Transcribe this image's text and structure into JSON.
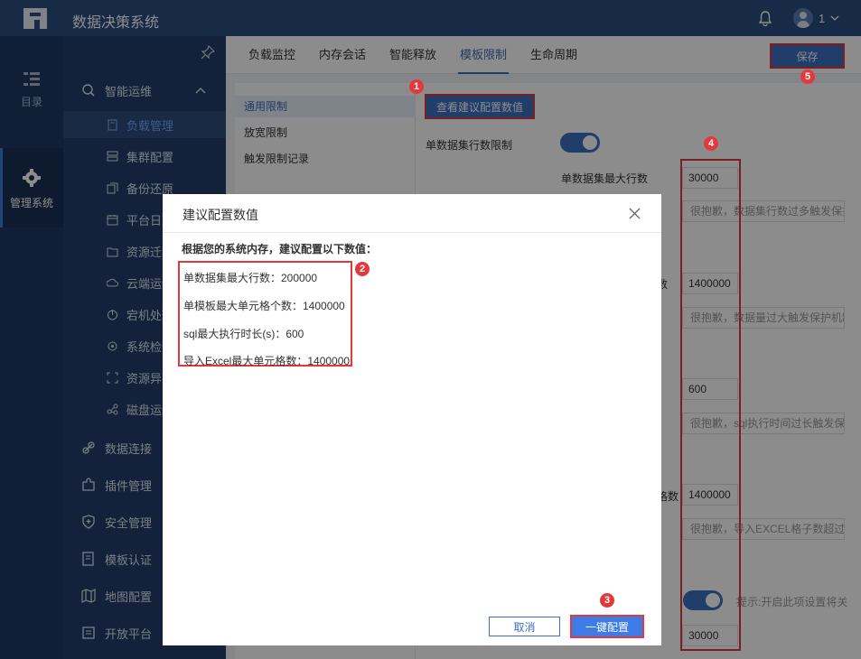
{
  "app": {
    "title": "数据决策系统",
    "user": "1"
  },
  "rail": [
    {
      "label": "目录",
      "icon": "list-icon"
    },
    {
      "label": "管理系统",
      "icon": "gear-icon"
    }
  ],
  "sidebar": {
    "groups": [
      {
        "label": "智能运维",
        "icon": "ops-icon"
      },
      {
        "label": "数据连接",
        "icon": "link-icon"
      },
      {
        "label": "插件管理",
        "icon": "plugin-icon"
      },
      {
        "label": "安全管理",
        "icon": "shield-icon"
      },
      {
        "label": "模板认证",
        "icon": "cert-icon"
      },
      {
        "label": "地图配置",
        "icon": "map-icon"
      },
      {
        "label": "开放平台",
        "icon": "platform-icon"
      }
    ],
    "items": [
      {
        "label": "负载管理"
      },
      {
        "label": "集群配置"
      },
      {
        "label": "备份还原"
      },
      {
        "label": "平台日志"
      },
      {
        "label": "资源迁移"
      },
      {
        "label": "云端运维"
      },
      {
        "label": "宕机处理"
      },
      {
        "label": "系统检查"
      },
      {
        "label": "资源异常"
      },
      {
        "label": "磁盘运维"
      }
    ]
  },
  "tabs": [
    "负载监控",
    "内存会话",
    "智能释放",
    "模板限制",
    "生命周期"
  ],
  "save_label": "保存",
  "subnav": [
    "通用限制",
    "放宽限制",
    "触发限制记录"
  ],
  "suggest_button": "查看建议配置数值",
  "form": {
    "dataset_limit_label": "单数据集行数限制",
    "dataset_max_rows_label": "单数据集最大行数",
    "values": [
      "30000",
      "1400000",
      "600",
      "1400000",
      "30000"
    ],
    "messages": [
      "很抱歉，数据集行数过多触发保护",
      "很抱歉，数据量过大触发保护机制",
      "很抱歉，sql执行时间过长触发保",
      "很抱歉，导入EXCEL格子数超过"
    ],
    "cell_label_suffix": "数",
    "cell_label_suffix2": "格数",
    "hint_text": "提示:开启此项设置将关"
  },
  "dialog": {
    "title": "建议配置数值",
    "lead": "根据您的系统内存，建议配置以下数值：",
    "lines": [
      "单数据集最大行数：200000",
      "单模板最大单元格个数：1400000",
      "sql最大执行时长(s)：600",
      "导入Excel最大单元格数：1400000"
    ],
    "cancel": "取消",
    "confirm": "一键配置"
  },
  "badges": [
    "1",
    "2",
    "3",
    "4",
    "5"
  ]
}
